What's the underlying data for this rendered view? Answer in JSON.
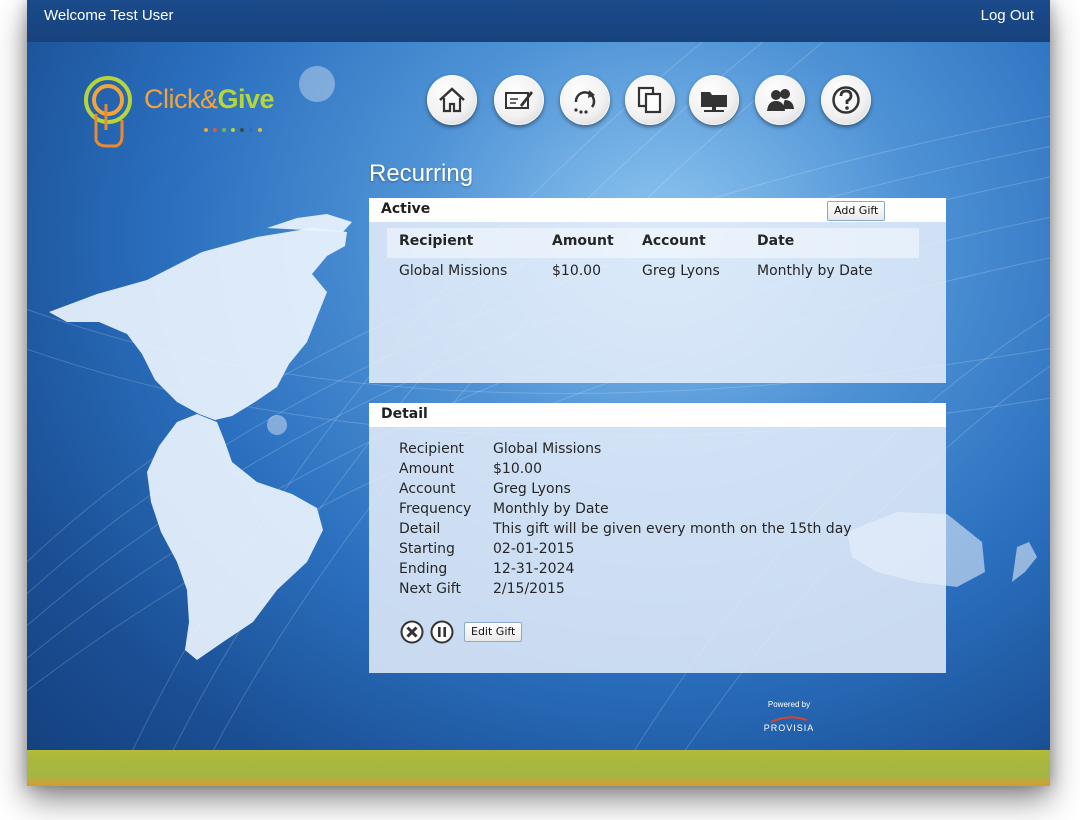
{
  "header": {
    "welcome": "Welcome Test User",
    "logout": "Log Out"
  },
  "logo": {
    "part1": "Click&",
    "part2": "Give"
  },
  "nav": {
    "icons": [
      "home-icon",
      "check-edit-icon",
      "recurring-icon",
      "copy-icon",
      "folder-icon",
      "users-icon",
      "help-icon"
    ]
  },
  "page": {
    "title": "Recurring"
  },
  "active": {
    "title": "Active",
    "add_button": "Add Gift",
    "columns": [
      "Recipient",
      "Amount",
      "Account",
      "Date"
    ],
    "rows": [
      {
        "recipient": "Global Missions",
        "amount": "$10.00",
        "account": "Greg Lyons",
        "date": "Monthly by Date"
      }
    ]
  },
  "detail": {
    "title": "Detail",
    "fields": [
      {
        "label": "Recipient",
        "value": "Global Missions"
      },
      {
        "label": "Amount",
        "value": "$10.00"
      },
      {
        "label": "Account",
        "value": "Greg Lyons"
      },
      {
        "label": "Frequency",
        "value": "Monthly by Date"
      },
      {
        "label": "Detail",
        "value": "This gift will be given every month on the 15th day"
      },
      {
        "label": "Starting",
        "value": "02-01-2015"
      },
      {
        "label": "Ending",
        "value": "12-31-2024"
      },
      {
        "label": "Next Gift",
        "value": "2/15/2015"
      }
    ],
    "edit_button": "Edit Gift",
    "action_icons": [
      "cancel-icon",
      "pause-icon"
    ]
  },
  "footer": {
    "powered_by": "Powered by",
    "brand": "PROVISIA"
  },
  "colors": {
    "accent_blue": "#1b4b8c",
    "logo_orange": "#f2a33a",
    "logo_green": "#b6d53b",
    "stripe_green": "#a9b83d"
  }
}
